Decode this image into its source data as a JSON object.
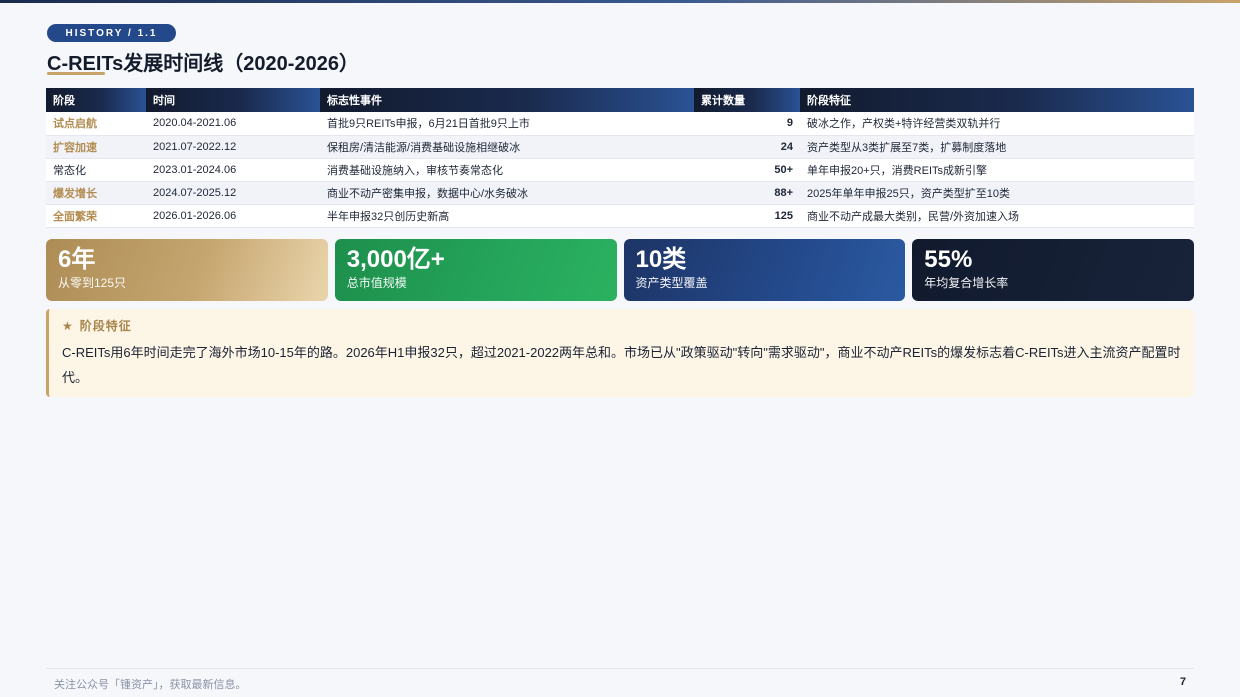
{
  "header": {
    "badge": "HISTORY / 1.1",
    "title": "C-REITs发展时间线（2020-2026）"
  },
  "table": {
    "headers": [
      "阶段",
      "时间",
      "标志性事件",
      "累计数量",
      "阶段特征"
    ],
    "rows": [
      {
        "phase": "试点启航",
        "period": "2020.04-2021.06",
        "event": "首批9只REITs申报，6月21日首批9只上市",
        "count": "9",
        "feature": "破冰之作，产权类+特许经营类双轨并行"
      },
      {
        "phase": "扩容加速",
        "period": "2021.07-2022.12",
        "event": "保租房/清洁能源/消费基础设施相继破冰",
        "count": "24",
        "feature": "资产类型从3类扩展至7类，扩募制度落地"
      },
      {
        "phase": "常态化",
        "period": "2023.01-2024.06",
        "event": "消费基础设施纳入，审核节奏常态化",
        "count": "50+",
        "feature": "单年申报20+只，消费REITs成新引擎"
      },
      {
        "phase": "爆发增长",
        "period": "2024.07-2025.12",
        "event": "商业不动产密集申报，数据中心/水务破冰",
        "count": "88+",
        "feature": "2025年单年申报25只，资产类型扩至10类"
      },
      {
        "phase": "全面繁荣",
        "period": "2026.01-2026.06",
        "event": "半年申报32只创历史新高",
        "count": "125",
        "feature": "商业不动产成最大类别，民营/外资加速入场"
      }
    ]
  },
  "stats": [
    {
      "value": "6年",
      "label": "从零到125只"
    },
    {
      "value": "3,000亿+",
      "label": "总市值规模"
    },
    {
      "value": "10类",
      "label": "资产类型覆盖"
    },
    {
      "value": "55%",
      "label": "年均复合增长率"
    }
  ],
  "feature_box": {
    "icon": "star-icon",
    "heading": "阶段特征",
    "text": "C-REITs用6年时间走完了海外市场10-15年的路。2026年H1申报32只，超过2021-2022两年总和。市场已从\"政策驱动\"转向\"需求驱动\"，商业不动产REITs的爆发标志着C-REITs进入主流资产配置时代。"
  },
  "footer": {
    "note": "关注公众号「锺资产」，获取最新信息。",
    "page_number": "7"
  },
  "colors": {
    "accent_gold": "#c8a36a",
    "navy": "#1a2a4d",
    "green": "#25a55b",
    "blue": "#244a8c",
    "dark": "#111a2d"
  }
}
